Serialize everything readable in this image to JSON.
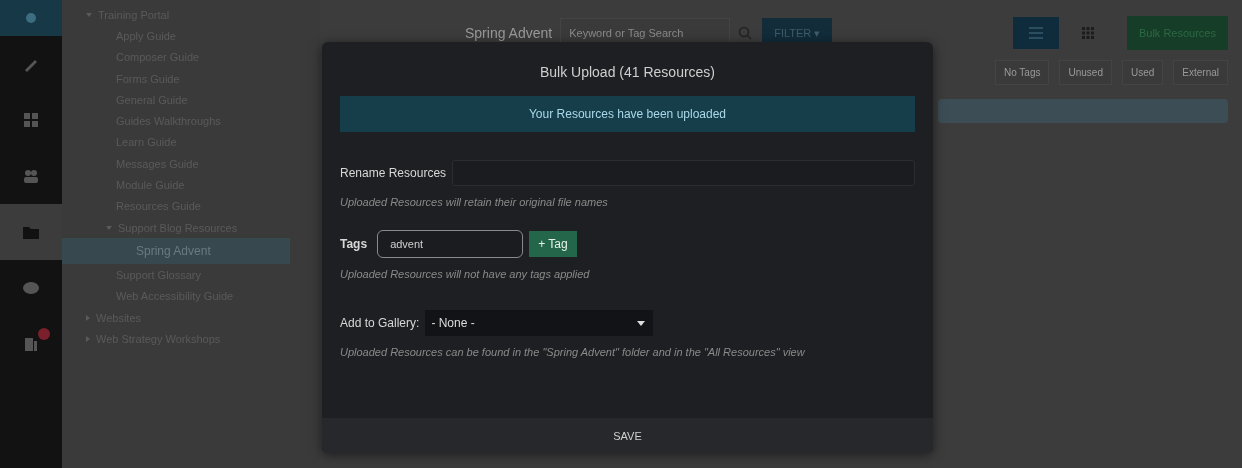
{
  "rail": {
    "items": [
      {
        "selected": false
      },
      {
        "selected": false
      },
      {
        "selected": false
      },
      {
        "selected": false
      },
      {
        "selected": true
      },
      {
        "selected": false
      },
      {
        "selected": false,
        "badge": true
      }
    ]
  },
  "tree": [
    {
      "label": "Training Portal",
      "expanded": true,
      "selected": false,
      "children": [
        {
          "label": "Apply Guide",
          "selected": false
        },
        {
          "label": "Composer Guide",
          "selected": false
        },
        {
          "label": "Forms Guide",
          "selected": false
        },
        {
          "label": "General Guide",
          "selected": false
        },
        {
          "label": "Guides Walkthroughs",
          "selected": false
        },
        {
          "label": "Learn Guide",
          "selected": false
        },
        {
          "label": "Messages Guide",
          "selected": false
        },
        {
          "label": "Module Guide",
          "selected": false
        },
        {
          "label": "Resources Guide",
          "selected": false
        },
        {
          "label": "Support Blog Resources",
          "expanded": true,
          "selected": false,
          "children": [
            {
              "label": "Spring Advent",
              "selected": true
            }
          ]
        },
        {
          "label": "Support Glossary",
          "selected": false
        },
        {
          "label": "Web Accessibility Guide",
          "selected": false
        }
      ]
    },
    {
      "label": "Websites",
      "expanded": false,
      "selected": false
    },
    {
      "label": "Web Strategy Workshops",
      "expanded": false,
      "selected": false
    }
  ],
  "toolbar": {
    "title": "Spring Advent",
    "search_placeholder": "Keyword or Tag Search",
    "filter": "FILTER ▾",
    "views": [
      {
        "kind": "list",
        "selected": true
      },
      {
        "kind": "grid",
        "selected": false
      }
    ],
    "upload": "Bulk Resources"
  },
  "filter_chips": [
    "No Tags",
    "Unused",
    "Used",
    "External"
  ],
  "modal": {
    "title": "Bulk Upload (41 Resources)",
    "alert": "Your Resources have been uploaded",
    "rename": {
      "label": "Rename Resources",
      "hint": "Uploaded Resources will retain their original file names"
    },
    "tags": {
      "label": "Tags",
      "value": "advent",
      "add_button": "+ Tag",
      "hint": "Uploaded Resources will not have any tags applied"
    },
    "gallery": {
      "label": "Add to Gallery:",
      "value": "- None -",
      "hint": "Uploaded Resources can be found in the \"Spring Advent\" folder and in the \"All Resources\" view"
    },
    "save": "SAVE"
  }
}
